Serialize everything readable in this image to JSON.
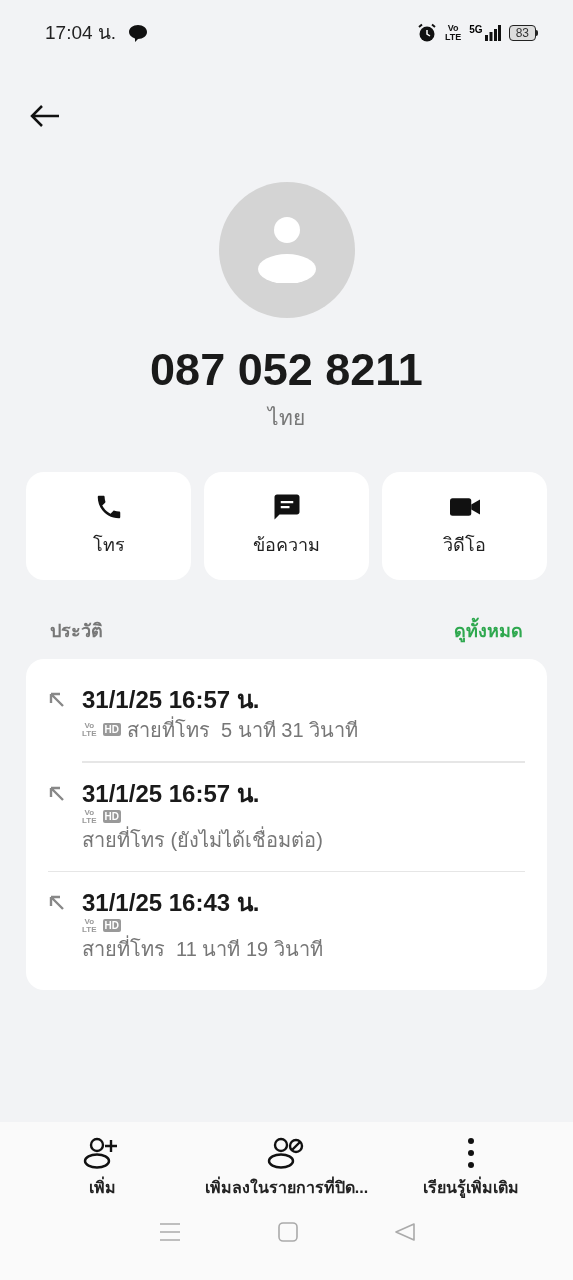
{
  "status_bar": {
    "time": "17:04 น.",
    "volte": {
      "top": "Vo",
      "bottom": "LTE"
    },
    "network": "5G",
    "battery": "83"
  },
  "contact": {
    "number": "087 052 8211",
    "location": "ไทย"
  },
  "actions": [
    {
      "kind": "call",
      "label": "โทร"
    },
    {
      "kind": "message",
      "label": "ข้อความ"
    },
    {
      "kind": "video",
      "label": "วิดีโอ"
    }
  ],
  "history": {
    "title": "ประวัติ",
    "view_all": "ดูทั้งหมด",
    "calls": [
      {
        "datetime": "31/1/25 16:57 น.",
        "volte": {
          "top": "Vo",
          "bottom": "LTE"
        },
        "hd": "HD",
        "detail": "สายที่โทร  5 นาที 31 วินาที",
        "inline": true
      },
      {
        "datetime": "31/1/25 16:57 น.",
        "volte": {
          "top": "Vo",
          "bottom": "LTE"
        },
        "hd": "HD",
        "detail": "สายที่โทร (ยังไม่ได้เชื่อมต่อ)",
        "inline": false
      },
      {
        "datetime": "31/1/25 16:43 น.",
        "volte": {
          "top": "Vo",
          "bottom": "LTE"
        },
        "hd": "HD",
        "detail": "สายที่โทร  11 นาที 19 วินาที",
        "inline": false
      }
    ]
  },
  "bottom_actions": [
    {
      "kind": "add",
      "label": "เพิ่ม"
    },
    {
      "kind": "block",
      "label": "เพิ่มลงในรายการที่ปิด..."
    },
    {
      "kind": "more",
      "label": "เรียนรู้เพิ่มเติม"
    }
  ]
}
